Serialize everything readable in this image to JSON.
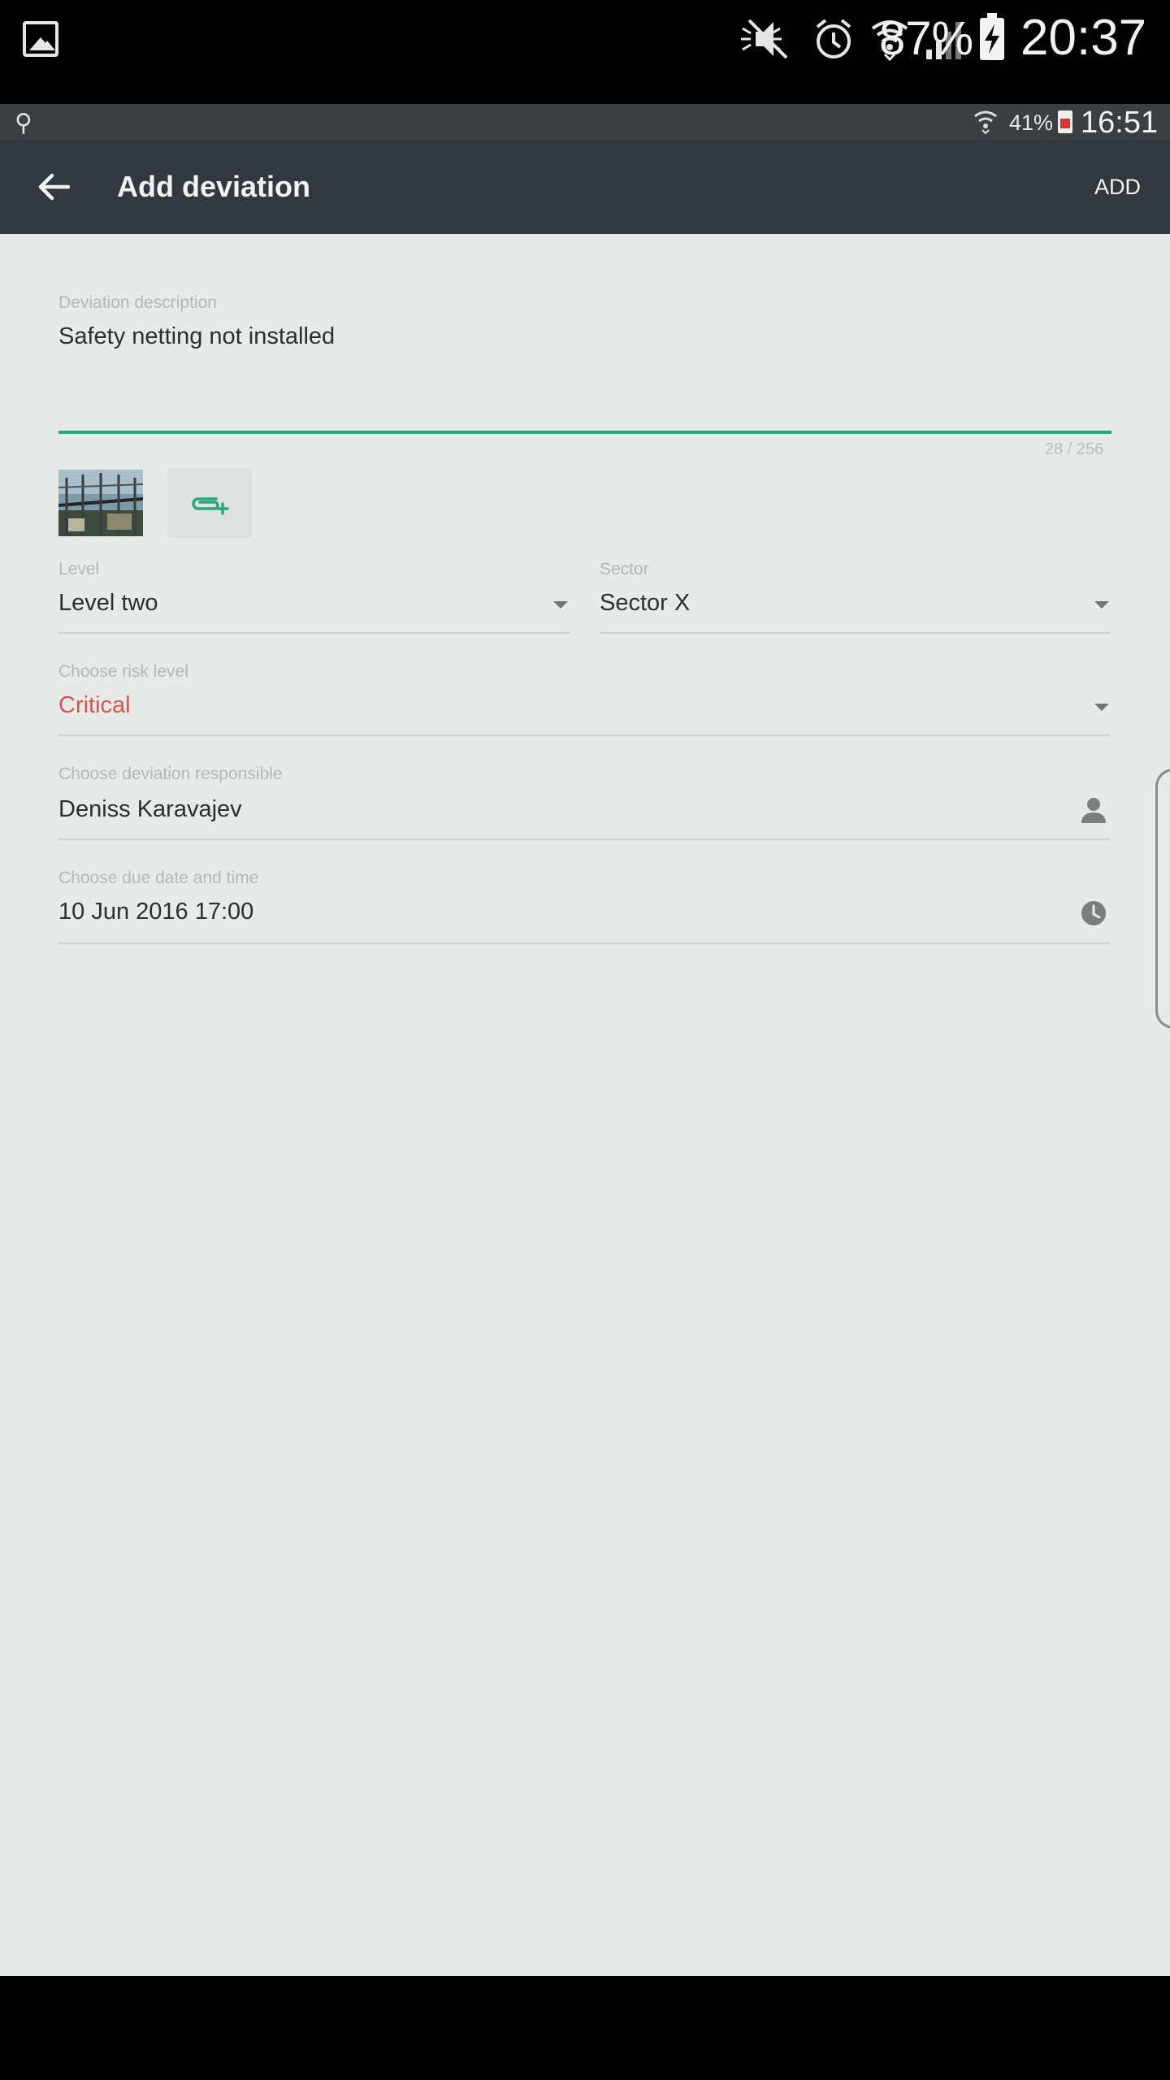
{
  "device_status": {
    "battery_percent": "87%",
    "time": "20:37",
    "icons": [
      "gallery-icon",
      "mute-icon",
      "alarm-icon",
      "wifi-icon",
      "signal-icon",
      "battery-charging-icon"
    ]
  },
  "app_status": {
    "battery_percent": "41%",
    "time": "16:51",
    "icons": [
      "usb-icon",
      "wifi-icon",
      "battery-icon"
    ]
  },
  "appbar": {
    "title": "Add deviation",
    "action": "ADD",
    "back_icon": "arrow-back-icon",
    "background": "#32393e"
  },
  "form": {
    "description": {
      "label": "Deviation description",
      "value": "Safety netting not installed",
      "counter": "28 / 256",
      "accent": "#27a87a"
    },
    "attachments": {
      "add_icon": "attach-add-icon"
    },
    "level": {
      "label": "Level",
      "value": "Level two"
    },
    "sector": {
      "label": "Sector",
      "value": "Sector X"
    },
    "risk": {
      "label": "Choose risk level",
      "value": "Critical",
      "color": "#d9534f"
    },
    "responsible": {
      "label": "Choose deviation responsible",
      "value": "Deniss Karavajev",
      "icon": "person-icon"
    },
    "due": {
      "label": "Choose due date and time",
      "value": "10 Jun 2016 17:00",
      "icon": "clock-icon"
    }
  }
}
